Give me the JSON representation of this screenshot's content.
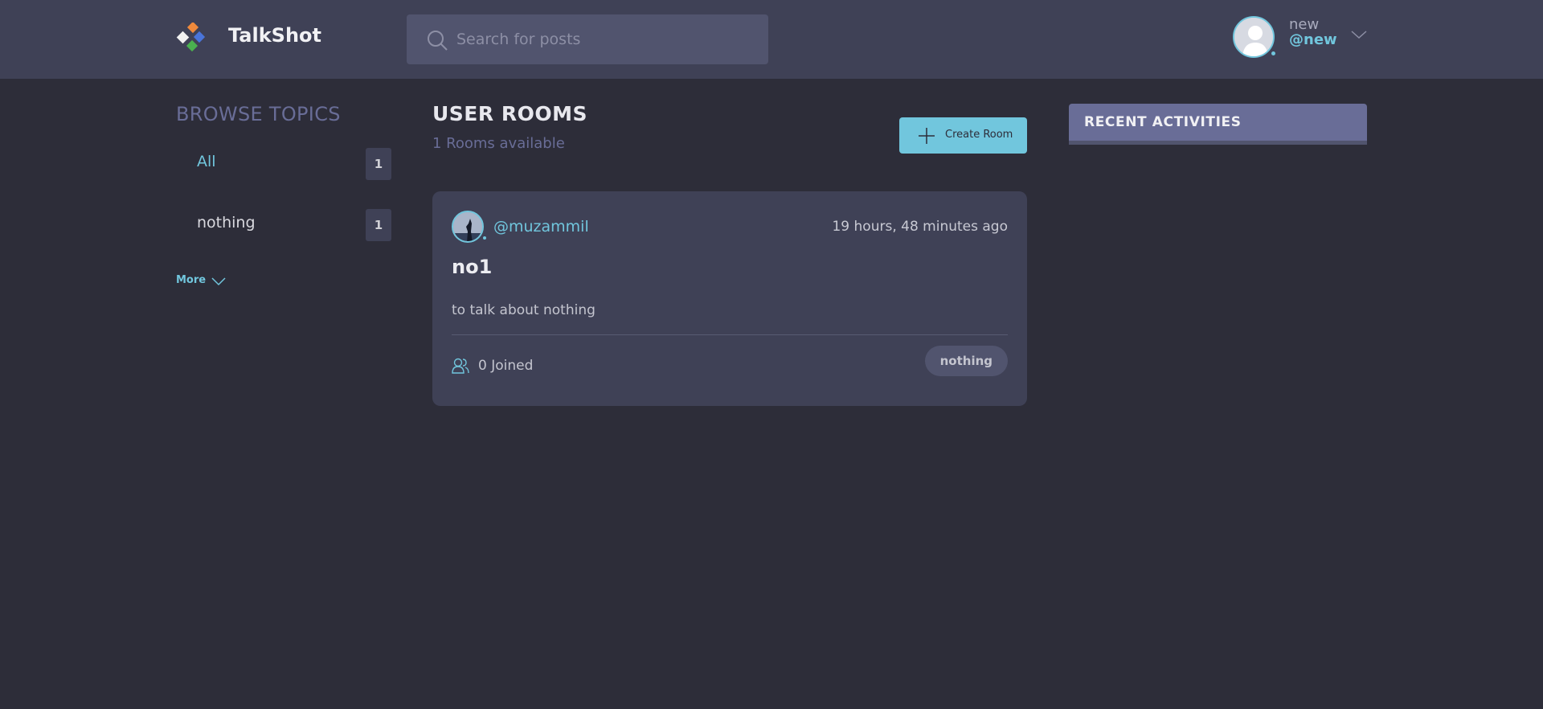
{
  "header": {
    "brand": "TalkShot",
    "search_placeholder": "Search for posts",
    "user": {
      "name": "new",
      "handle": "@new"
    }
  },
  "topics": {
    "title": "BROWSE TOPICS",
    "items": [
      {
        "label": "All",
        "count": "1",
        "active": true
      },
      {
        "label": "nothing",
        "count": "1",
        "active": false
      }
    ],
    "more_label": "More"
  },
  "main": {
    "title": "USER ROOMS",
    "subtitle": "1 Rooms available",
    "create_label": "Create Room",
    "rooms": [
      {
        "host": "@muzammil",
        "time": "19 hours, 48 minutes ago",
        "name": "no1",
        "description": "to talk about nothing",
        "joined": "0 Joined",
        "topic": "nothing"
      }
    ]
  },
  "activities": {
    "title": "RECENT ACTIVITIES"
  },
  "colors": {
    "background": "#2d2d39",
    "header": "#3f4156",
    "accent": "#71c6dd",
    "muted": "#696d97"
  }
}
